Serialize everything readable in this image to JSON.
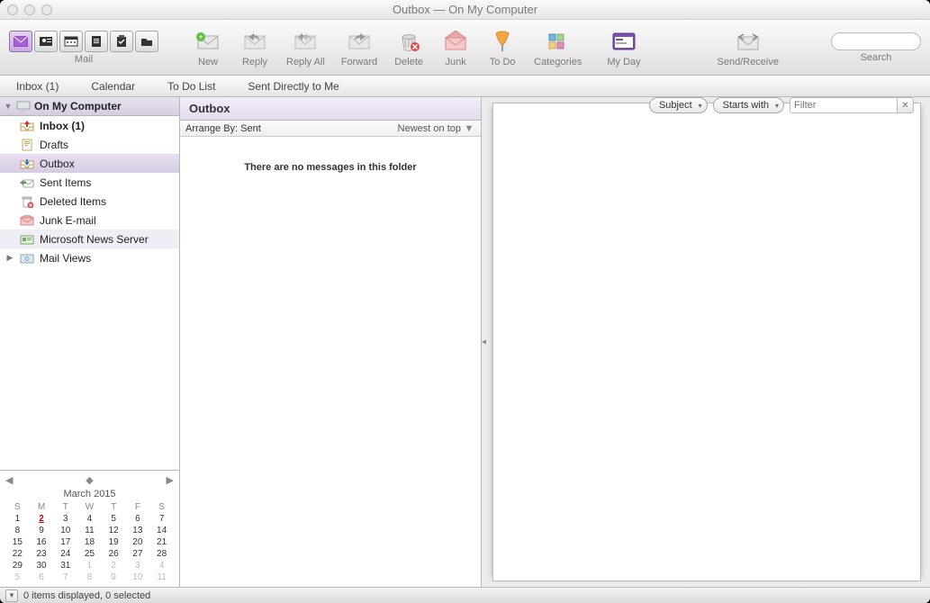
{
  "window": {
    "title": "Outbox — On My Computer"
  },
  "toolbar": {
    "mail_group_label": "Mail",
    "new_label": "New",
    "reply_label": "Reply",
    "reply_all_label": "Reply All",
    "forward_label": "Forward",
    "delete_label": "Delete",
    "junk_label": "Junk",
    "todo_label": "To Do",
    "categories_label": "Categories",
    "myday_label": "My Day",
    "sendreceive_label": "Send/Receive",
    "search_label": "Search",
    "search_placeholder": ""
  },
  "viewbar": {
    "inbox": "Inbox (1)",
    "calendar": "Calendar",
    "todolist": "To Do List",
    "sent_directly": "Sent Directly to Me"
  },
  "sidebar": {
    "root_label": "On My Computer",
    "folders": [
      {
        "label": "Inbox (1)",
        "bold": true,
        "icon": "inbox-icon"
      },
      {
        "label": "Drafts",
        "icon": "drafts-icon"
      },
      {
        "label": "Outbox",
        "icon": "outbox-icon",
        "selected": true
      },
      {
        "label": "Sent Items",
        "icon": "sent-icon"
      },
      {
        "label": "Deleted Items",
        "icon": "trash-icon"
      },
      {
        "label": "Junk E-mail",
        "icon": "junk-icon"
      },
      {
        "label": "Microsoft News Server",
        "icon": "news-icon",
        "alt": true
      }
    ],
    "mail_views_label": "Mail Views"
  },
  "calendar": {
    "title": "March 2015",
    "dow": [
      "S",
      "M",
      "T",
      "W",
      "T",
      "F",
      "S"
    ],
    "weeks": [
      [
        {
          "d": 1
        },
        {
          "d": 2,
          "today": true
        },
        {
          "d": 3
        },
        {
          "d": 4
        },
        {
          "d": 5
        },
        {
          "d": 6
        },
        {
          "d": 7
        }
      ],
      [
        {
          "d": 8
        },
        {
          "d": 9
        },
        {
          "d": 10
        },
        {
          "d": 11
        },
        {
          "d": 12
        },
        {
          "d": 13
        },
        {
          "d": 14
        }
      ],
      [
        {
          "d": 15
        },
        {
          "d": 16
        },
        {
          "d": 17
        },
        {
          "d": 18
        },
        {
          "d": 19
        },
        {
          "d": 20
        },
        {
          "d": 21
        }
      ],
      [
        {
          "d": 22
        },
        {
          "d": 23
        },
        {
          "d": 24
        },
        {
          "d": 25
        },
        {
          "d": 26
        },
        {
          "d": 27
        },
        {
          "d": 28
        }
      ],
      [
        {
          "d": 29
        },
        {
          "d": 30
        },
        {
          "d": 31
        },
        {
          "d": 1,
          "dim": true
        },
        {
          "d": 2,
          "dim": true
        },
        {
          "d": 3,
          "dim": true
        },
        {
          "d": 4,
          "dim": true
        }
      ],
      [
        {
          "d": 5,
          "dim": true
        },
        {
          "d": 6,
          "dim": true
        },
        {
          "d": 7,
          "dim": true
        },
        {
          "d": 8,
          "dim": true
        },
        {
          "d": 9,
          "dim": true
        },
        {
          "d": 10,
          "dim": true
        },
        {
          "d": 11,
          "dim": true
        }
      ]
    ]
  },
  "list": {
    "header_title": "Outbox",
    "filter_field": "Subject",
    "filter_op": "Starts with",
    "filter_placeholder": "Filter",
    "arrange_label": "Arrange By: Sent",
    "sort_label": "Newest on top",
    "empty_message": "There are no messages in this folder"
  },
  "status": {
    "text": "0 items displayed, 0 selected"
  }
}
